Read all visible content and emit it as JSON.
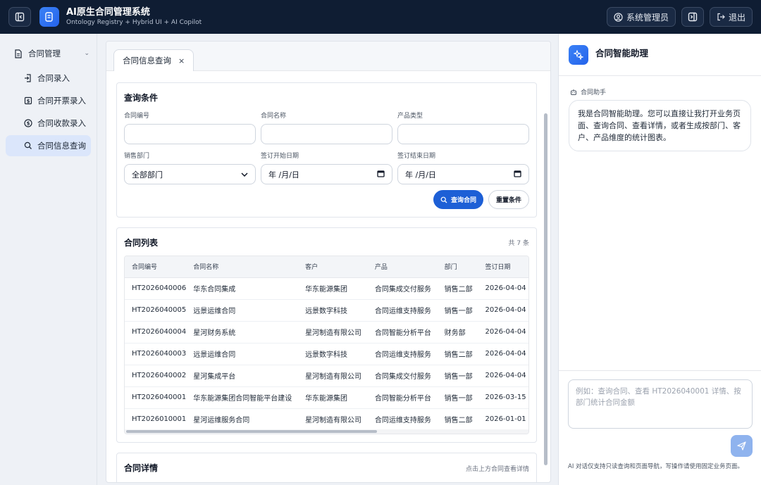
{
  "app": {
    "title": "AI原生合同管理系统",
    "subtitle": "Ontology Registry + Hybrid UI + AI Copilot",
    "user_label": "系统管理员",
    "logout_label": "退出"
  },
  "sidebar": {
    "group_label": "合同管理",
    "items": [
      {
        "label": "合同录入",
        "icon": "document-arrow-icon"
      },
      {
        "label": "合同开票录入",
        "icon": "invoice-icon"
      },
      {
        "label": "合同收款录入",
        "icon": "dollar-circle-icon"
      },
      {
        "label": "合同信息查询",
        "icon": "search-icon",
        "active": true
      }
    ]
  },
  "tab": {
    "label": "合同信息查询",
    "close": "×"
  },
  "query": {
    "title": "查询条件",
    "fields": {
      "contract_no": {
        "label": "合同编号",
        "value": ""
      },
      "contract_name": {
        "label": "合同名称",
        "value": ""
      },
      "product_type": {
        "label": "产品类型",
        "value": ""
      },
      "department": {
        "label": "销售部门",
        "value": "全部部门"
      },
      "start_date": {
        "label": "签订开始日期",
        "value": "年 /月/日"
      },
      "end_date": {
        "label": "签订结束日期",
        "value": "年 /月/日"
      }
    },
    "search_label": "查询合同",
    "reset_label": "重置条件"
  },
  "list": {
    "title": "合同列表",
    "count": "共 7 条",
    "columns": [
      "合同编号",
      "合同名称",
      "客户",
      "产品",
      "部门",
      "签订日期"
    ],
    "rows": [
      [
        "HT2026040006",
        "华东合同集成",
        "华东能源集团",
        "合同集成交付服务",
        "销售二部",
        "2026-04-04"
      ],
      [
        "HT2026040005",
        "远景运维合同",
        "远景数字科技",
        "合同运维支持服务",
        "销售一部",
        "2026-04-04"
      ],
      [
        "HT2026040004",
        "星河财务系统",
        "星河制造有限公司",
        "合同智能分析平台",
        "财务部",
        "2026-04-04"
      ],
      [
        "HT2026040003",
        "远景运维合同",
        "远景数字科技",
        "合同运维支持服务",
        "销售二部",
        "2026-04-04"
      ],
      [
        "HT2026040002",
        "星河集成平台",
        "星河制造有限公司",
        "合同集成交付服务",
        "销售一部",
        "2026-04-04"
      ],
      [
        "HT2026040001",
        "华东能源集团合同智能平台建设",
        "华东能源集团",
        "合同智能分析平台",
        "销售一部",
        "2026-03-15"
      ],
      [
        "HT2026010001",
        "星河运维服务合同",
        "星河制造有限公司",
        "合同运维支持服务",
        "销售二部",
        "2026-01-01"
      ]
    ]
  },
  "detail": {
    "title": "合同详情",
    "hint": "点击上方合同查看详情"
  },
  "assistant": {
    "title": "合同智能助理",
    "role": "合同助手",
    "message": "我是合同智能助理。您可以直接让我打开业务页面、查询合同、查看详情，或者生成按部门、客户、产品维度的统计图表。",
    "input_placeholder": "例如：查询合同、查看 HT2026040001 详情、按部门统计合同金额",
    "note": "AI 对话仅支持只读查询和页面导航，写操作请使用固定业务页面。"
  },
  "colors": {
    "accent": "#1d5fd6",
    "topbar": "#0f1d33",
    "active_nav": "#dbe6fb"
  }
}
